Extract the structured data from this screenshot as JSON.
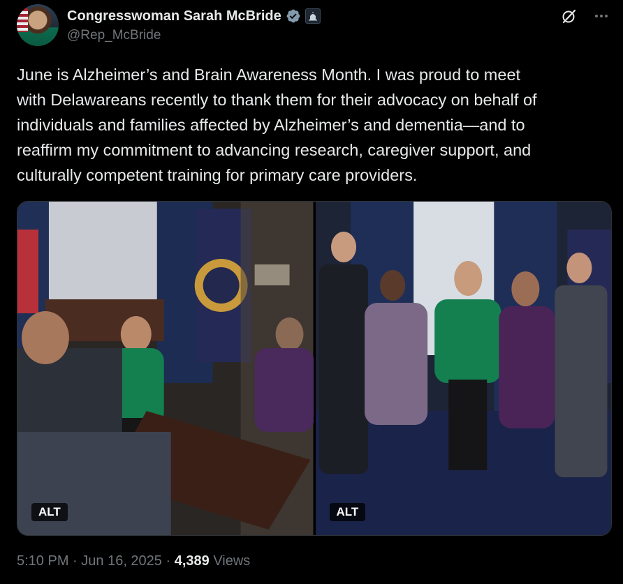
{
  "author": {
    "display_name": "Congresswoman Sarah McBride",
    "handle": "@Rep_McBride"
  },
  "icons": {
    "verified": "verified-badge-icon",
    "government": "capitol-badge-icon",
    "grok": "grok-icon",
    "more": "more-icon"
  },
  "tweet": {
    "text": "June is Alzheimer’s and Brain Awareness Month. I was proud to meet\nwith Delawareans recently to thank them for their advocacy on behalf of\nindividuals and families affected by Alzheimer’s and dementia—and to\nreaffirm my commitment to advancing research, caregiver support, and\nculturally competent training for primary care providers."
  },
  "media": [
    {
      "alt_label": "ALT"
    },
    {
      "alt_label": "ALT"
    }
  ],
  "meta": {
    "time": "5:10 PM",
    "sep1": " · ",
    "date": "Jun 16, 2025",
    "sep2": " · ",
    "views_count": "4,389",
    "views_label": " Views"
  },
  "colors": {
    "background": "#000000",
    "text": "#e7e9ea",
    "secondary": "#71767b",
    "verified": "#829aab"
  }
}
